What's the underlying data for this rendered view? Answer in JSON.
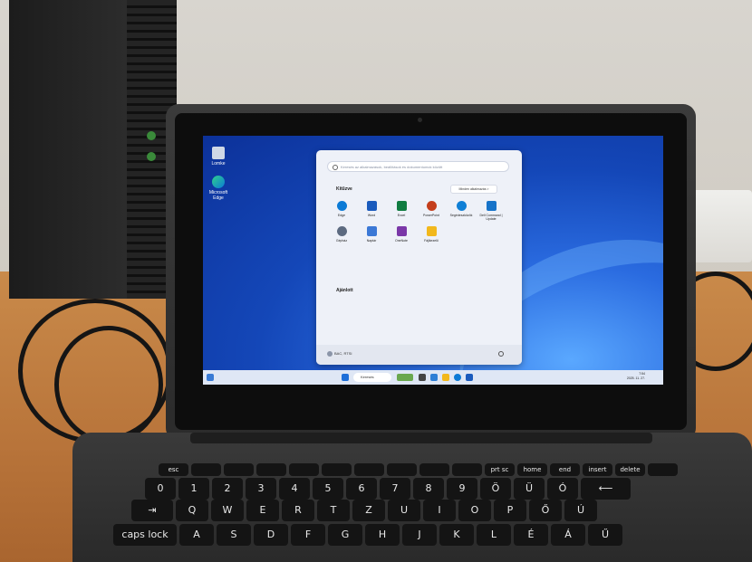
{
  "desktop": {
    "icons": [
      {
        "label": "Lomke",
        "icon": "recycle-bin-icon"
      },
      {
        "label": "Microsoft Edge",
        "icon": "edge-icon"
      }
    ]
  },
  "start_menu": {
    "search_placeholder": "Keresés az alkalmazások, beállítások és dokumentumok között",
    "pinned_title": "Kitűzve",
    "all_apps_label": "Minden alkalmazás >",
    "pinned_apps": [
      {
        "label": "Edge",
        "icon": "edge-icon",
        "color": "#0b7ad6"
      },
      {
        "label": "Word",
        "icon": "word-icon",
        "color": "#1a5bbd"
      },
      {
        "label": "Excel",
        "icon": "excel-icon",
        "color": "#107c41"
      },
      {
        "label": "PowerPoint",
        "icon": "powerpoint-icon",
        "color": "#c43e1c"
      },
      {
        "label": "Segédeszközök",
        "icon": "quick-assist-icon",
        "color": "#0f7fd6"
      },
      {
        "label": "Dell Command | Update",
        "icon": "dell-update-icon",
        "color": "#1673c9"
      },
      {
        "label": "Gépház",
        "icon": "settings-icon",
        "color": "#5c6a80"
      },
      {
        "label": "Naptár",
        "icon": "calendar-icon",
        "color": "#3b78d6"
      },
      {
        "label": "OneNote",
        "icon": "onenote-icon",
        "color": "#7a37a8"
      },
      {
        "label": "Fájlkezelő",
        "icon": "file-explorer-icon",
        "color": "#f2b81c"
      }
    ],
    "recommended_title": "Ajánlott",
    "user_name": "BAC, RTSI",
    "power_icon": "power-icon"
  },
  "taskbar": {
    "search_label": "Keresés",
    "time": "7:54",
    "date": "2025. 11. 27."
  },
  "keyboard": {
    "fn_row": [
      "esc",
      "",
      "",
      "",
      "",
      "",
      "",
      "",
      "",
      "",
      "prt sc",
      "home",
      "end",
      "insert",
      "delete",
      ""
    ],
    "num_row": [
      "0",
      "1",
      "2",
      "3",
      "4",
      "5",
      "6",
      "7",
      "8",
      "9",
      "Ö",
      "Ü",
      "Ó",
      "⟵"
    ],
    "q_row": [
      "⇥",
      "Q",
      "W",
      "E",
      "R",
      "T",
      "Z",
      "U",
      "I",
      "O",
      "P",
      "Ő",
      "Ú"
    ],
    "a_row": [
      "caps lock",
      "A",
      "S",
      "D",
      "F",
      "G",
      "H",
      "J",
      "K",
      "L",
      "É",
      "Á",
      "Ű"
    ]
  }
}
